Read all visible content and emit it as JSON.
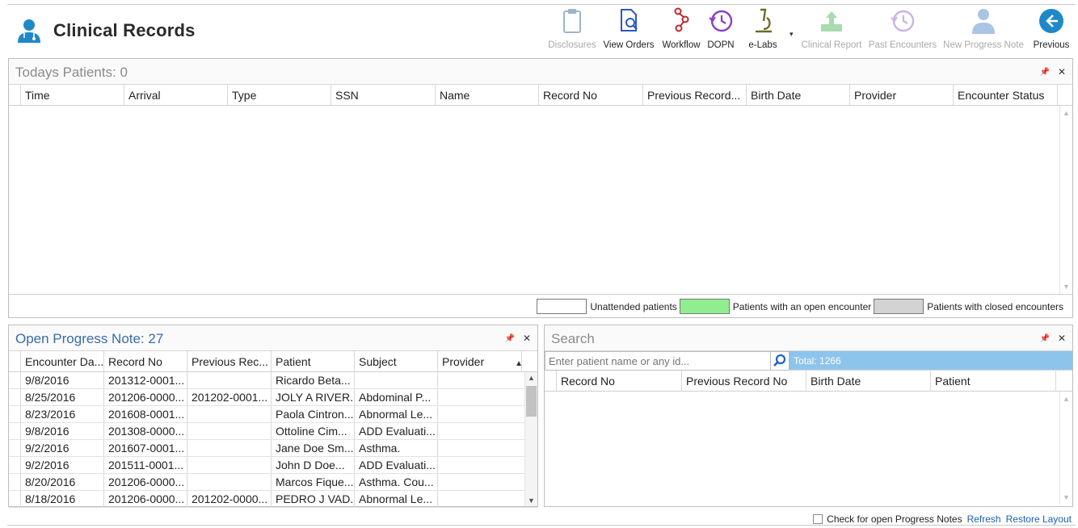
{
  "app": {
    "title": "Clinical Records",
    "accent_color": "#1e88c8"
  },
  "toolbar": {
    "buttons": [
      {
        "label": "Disclosures",
        "icon": "clipboard-icon",
        "enabled": false
      },
      {
        "label": "View Orders",
        "icon": "document-search-icon",
        "enabled": true
      },
      {
        "label": "Workflow",
        "icon": "workflow-icon",
        "enabled": true
      },
      {
        "label": "DOPN",
        "icon": "clock-history-icon",
        "enabled": true
      },
      {
        "label": "e-Labs",
        "icon": "microscope-icon",
        "enabled": true
      },
      {
        "label": "Clinical Report",
        "icon": "upload-tray-icon",
        "enabled": false
      },
      {
        "label": "Past Encounters",
        "icon": "clock-history-icon",
        "enabled": false
      },
      {
        "label": "New Progress Note",
        "icon": "doctor-icon",
        "enabled": false
      },
      {
        "label": "Previous",
        "icon": "arrow-left-circle-icon",
        "enabled": true
      }
    ]
  },
  "todays_patients": {
    "title": "Todays Patients: 0",
    "columns": [
      "Time",
      "Arrival",
      "Type",
      "SSN",
      "Name",
      "Record No",
      "Previous Record...",
      "Birth Date",
      "Provider",
      "Encounter Status"
    ],
    "rows": []
  },
  "legend": {
    "items": [
      {
        "label": "Unattended patients",
        "color": "#ffffff"
      },
      {
        "label": "Patients with an open encounter",
        "color": "#90ee90"
      },
      {
        "label": "Patients with closed encounters",
        "color": "#d3d3d3"
      }
    ]
  },
  "open_progress_note": {
    "title": "Open Progress Note: 27",
    "columns": [
      "Encounter Da...",
      "Record No",
      "Previous Rec...",
      "Patient",
      "Subject",
      "Provider"
    ],
    "rows": [
      [
        "9/8/2016",
        "201312-0001...",
        "",
        "Ricardo Beta...",
        "",
        ""
      ],
      [
        "8/25/2016",
        "201206-0000...",
        "201202-0001...",
        "JOLY A RIVER...",
        "Abdominal P...",
        ""
      ],
      [
        "8/23/2016",
        "201608-0001...",
        "",
        "Paola Cintron...",
        "Abnormal Le...",
        ""
      ],
      [
        "9/8/2016",
        "201308-0000...",
        "",
        "Ottoline Cim...",
        "ADD Evaluati...",
        ""
      ],
      [
        "9/2/2016",
        "201607-0001...",
        "",
        "Jane  Doe Sm...",
        "Asthma.",
        ""
      ],
      [
        "9/2/2016",
        "201511-0001...",
        "",
        "John  D Doe...",
        "ADD Evaluati...",
        ""
      ],
      [
        "8/20/2016",
        "201206-0000...",
        "",
        "Marcos Fique...",
        "Asthma.  Cou...",
        ""
      ],
      [
        "8/18/2016",
        "201206-0000...",
        "201202-0000...",
        "PEDRO J VAD...",
        "Abnormal Le...",
        ""
      ]
    ]
  },
  "search": {
    "title": "Search",
    "placeholder": "Enter patient name or any id...",
    "total": "Total: 1266",
    "columns": [
      "Record No",
      "Previous Record No",
      "Birth Date",
      "Patient"
    ]
  },
  "footer": {
    "checkbox_label": "Check for open Progress Notes",
    "refresh": "Refresh",
    "restore_layout": "Restore Layout"
  }
}
